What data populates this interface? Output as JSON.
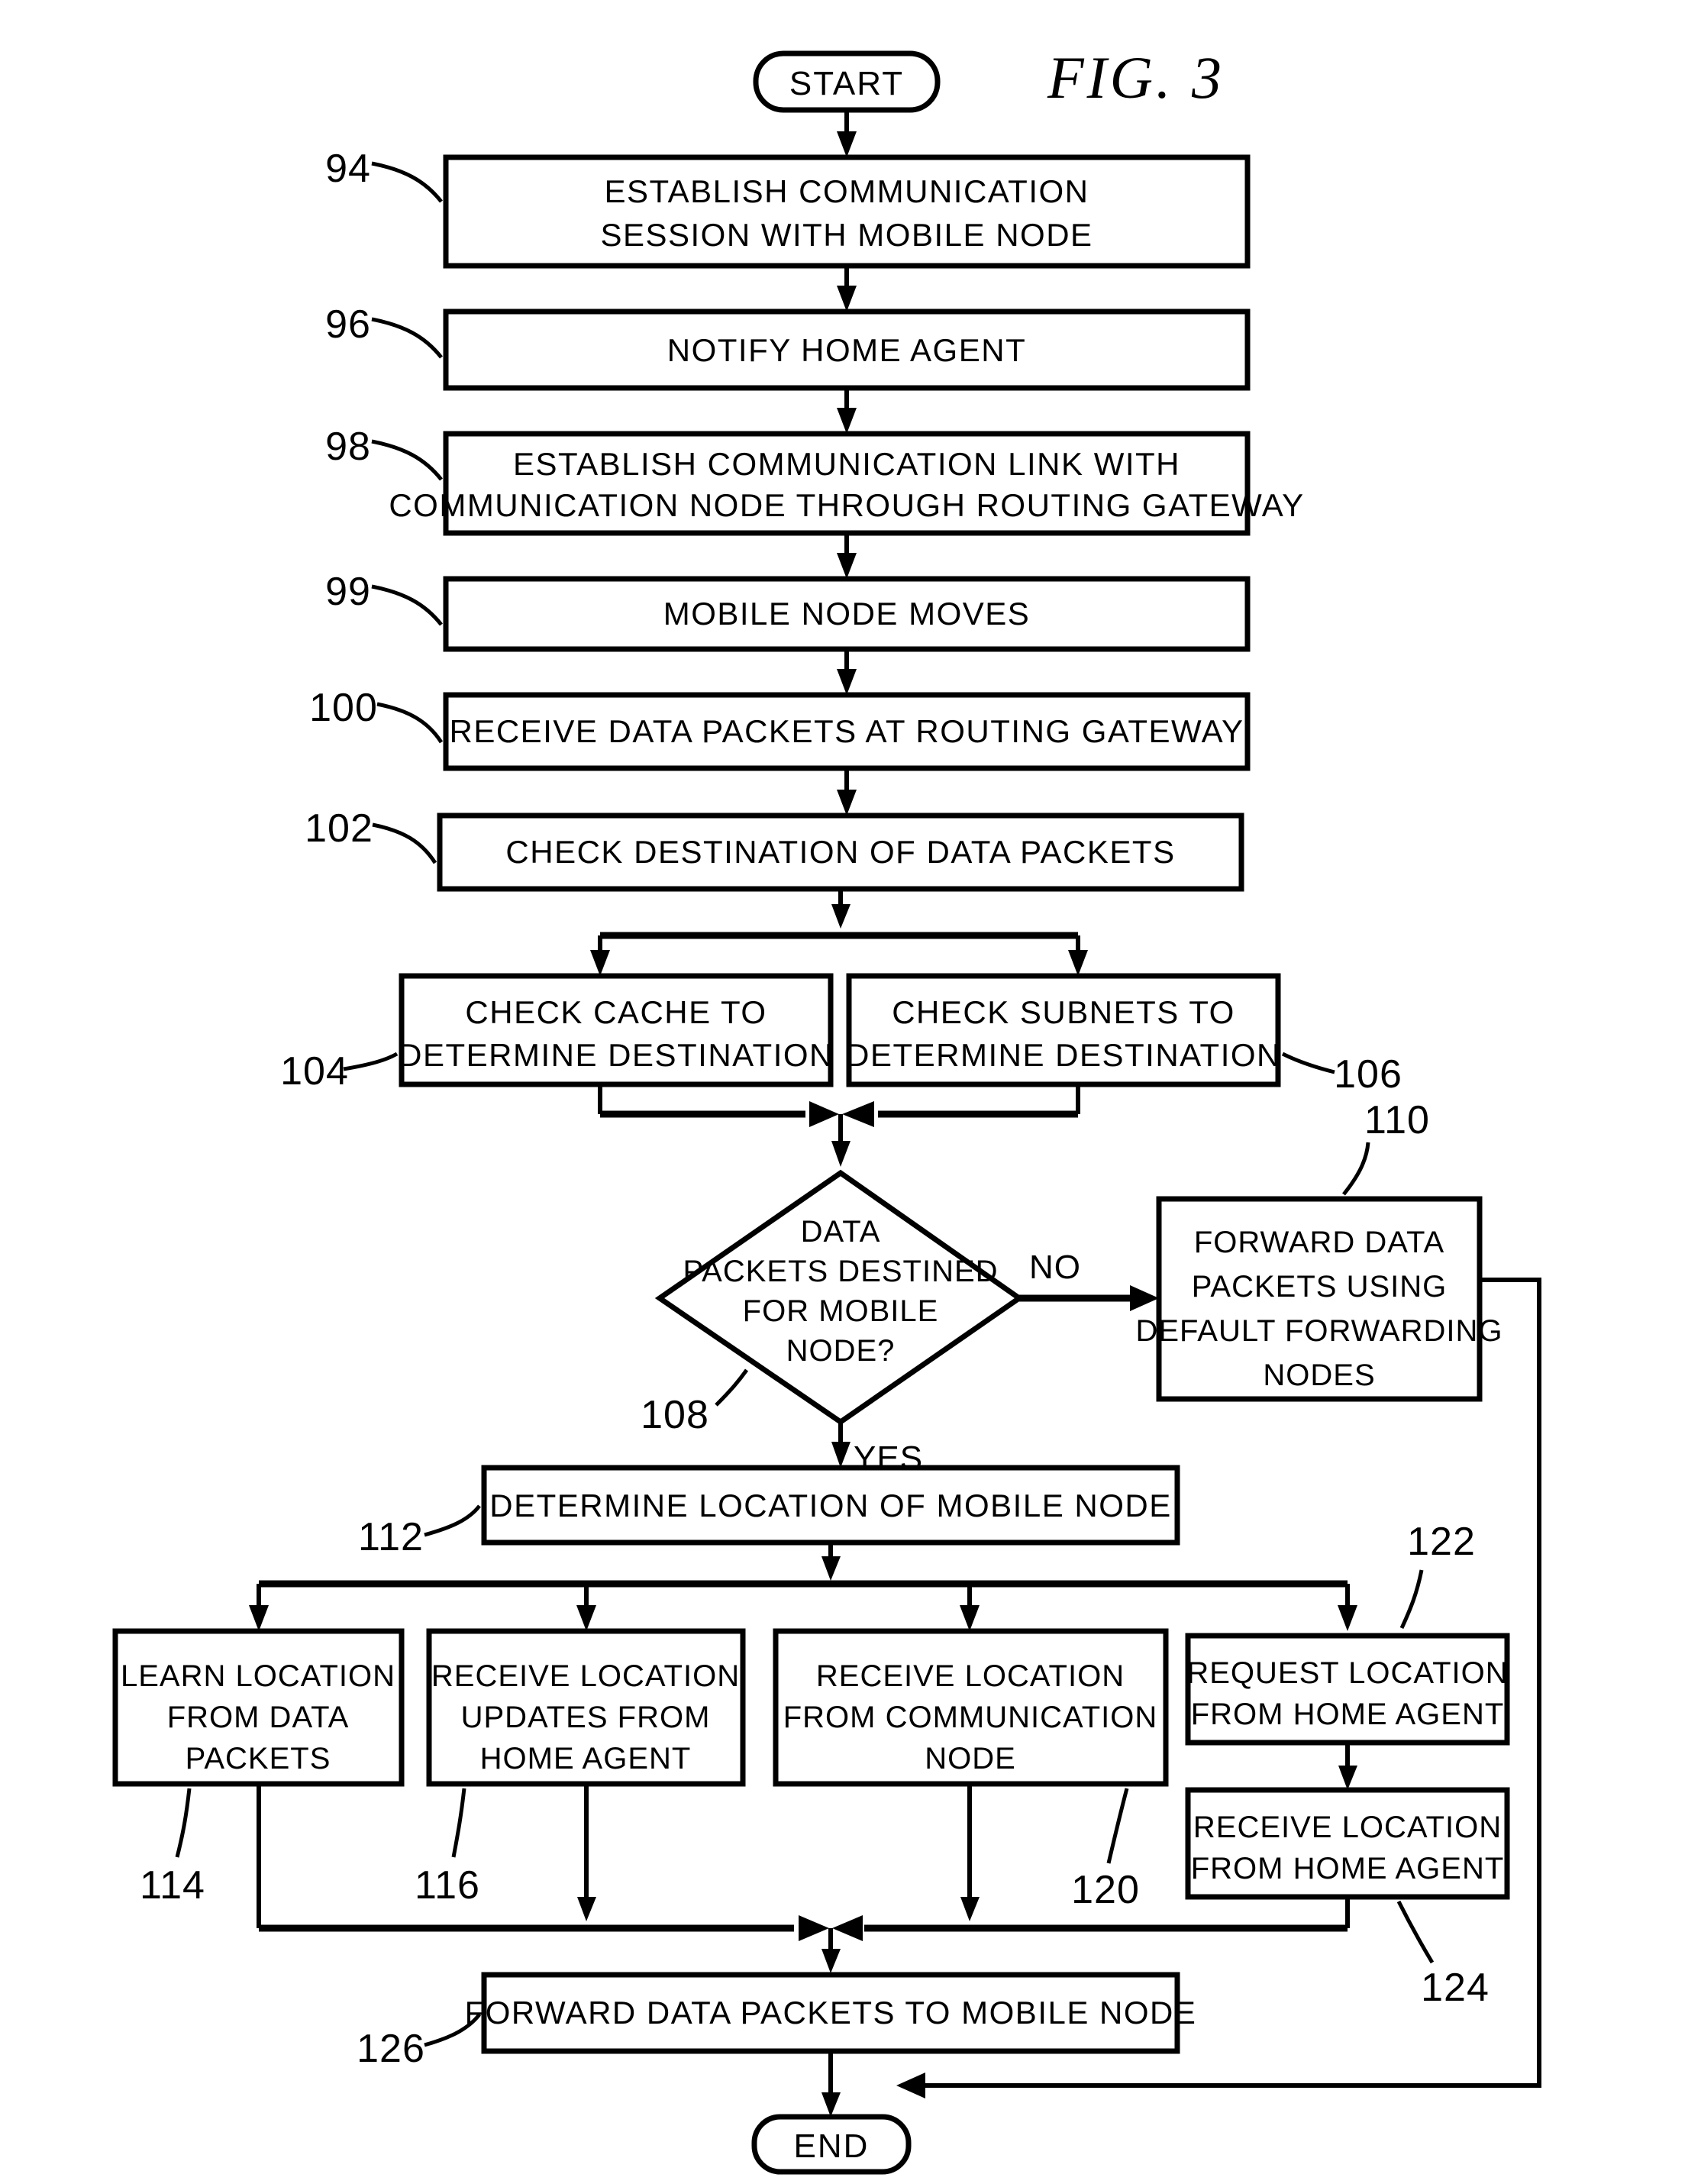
{
  "figure": {
    "title": "FIG. 3",
    "type": "patent-flowchart"
  },
  "terminals": {
    "start": "START",
    "end": "END"
  },
  "edge_labels": {
    "no": "NO",
    "yes": "YES"
  },
  "nodes": [
    {
      "ref": "94",
      "kind": "process",
      "lines": [
        "ESTABLISH COMMUNICATION",
        "SESSION WITH MOBILE NODE"
      ]
    },
    {
      "ref": "96",
      "kind": "process",
      "lines": [
        "NOTIFY HOME AGENT"
      ]
    },
    {
      "ref": "98",
      "kind": "process",
      "lines": [
        "ESTABLISH COMMUNICATION LINK WITH",
        "COMMUNICATION NODE THROUGH ROUTING GATEWAY"
      ]
    },
    {
      "ref": "99",
      "kind": "process",
      "lines": [
        "MOBILE NODE MOVES"
      ]
    },
    {
      "ref": "100",
      "kind": "process",
      "lines": [
        "RECEIVE DATA PACKETS AT ROUTING GATEWAY"
      ]
    },
    {
      "ref": "102",
      "kind": "process",
      "lines": [
        "CHECK DESTINATION OF DATA PACKETS"
      ]
    },
    {
      "ref": "104",
      "kind": "process",
      "lines": [
        "CHECK CACHE TO",
        "DETERMINE DESTINATION"
      ]
    },
    {
      "ref": "106",
      "kind": "process",
      "lines": [
        "CHECK SUBNETS TO",
        "DETERMINE DESTINATION"
      ]
    },
    {
      "ref": "108",
      "kind": "decision",
      "lines": [
        "DATA",
        "PACKETS DESTINED",
        "FOR MOBILE",
        "NODE?"
      ]
    },
    {
      "ref": "110",
      "kind": "process",
      "lines": [
        "FORWARD DATA",
        "PACKETS USING",
        "DEFAULT FORWARDING",
        "NODES"
      ]
    },
    {
      "ref": "112",
      "kind": "process",
      "lines": [
        "DETERMINE LOCATION OF MOBILE NODE"
      ]
    },
    {
      "ref": "114",
      "kind": "process",
      "lines": [
        "LEARN LOCATION",
        "FROM DATA",
        "PACKETS"
      ]
    },
    {
      "ref": "116",
      "kind": "process",
      "lines": [
        "RECEIVE LOCATION",
        "UPDATES FROM",
        "HOME AGENT"
      ]
    },
    {
      "ref": "120",
      "kind": "process",
      "lines": [
        "RECEIVE LOCATION",
        "FROM COMMUNICATION",
        "NODE"
      ]
    },
    {
      "ref": "122",
      "kind": "process",
      "lines": [
        "REQUEST LOCATION",
        "FROM HOME AGENT"
      ]
    },
    {
      "ref": "124",
      "kind": "process",
      "lines": [
        "RECEIVE LOCATION",
        "FROM HOME AGENT"
      ]
    },
    {
      "ref": "126",
      "kind": "process",
      "lines": [
        "FORWARD DATA PACKETS TO MOBILE NODE"
      ]
    }
  ],
  "colors": {
    "ink": "#000000",
    "paper": "#ffffff"
  }
}
